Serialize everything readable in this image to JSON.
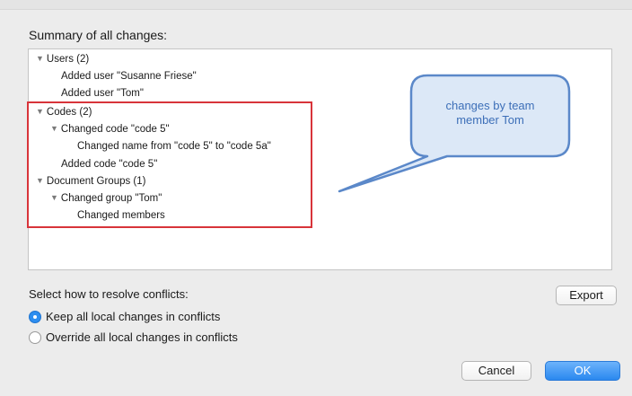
{
  "dialog": {
    "summary_title": "Summary of all changes:",
    "tree": {
      "users_group": "Users (2)",
      "added_user_1": "Added user \"Susanne Friese\"",
      "added_user_2": "Added user \"Tom\"",
      "codes_group": "Codes (2)",
      "changed_code": "Changed code \"code 5\"",
      "changed_name": "Changed name from \"code 5\" to \"code 5a\"",
      "added_code": "Added code \"code 5\"",
      "doc_groups_group": "Document Groups (1)",
      "changed_group": "Changed group \"Tom\"",
      "changed_members": "Changed members"
    },
    "callout": {
      "line1": "changes by team",
      "line2": "member Tom",
      "highlight_color": "#d8343a",
      "bubble_color": "#5b88c9"
    },
    "resolve_label": "Select how to resolve conflicts:",
    "options": {
      "keep": "Keep all local changes in conflicts",
      "override": "Override all local changes in conflicts",
      "selected": "keep"
    },
    "buttons": {
      "export": "Export",
      "cancel": "Cancel",
      "ok": "OK"
    }
  }
}
